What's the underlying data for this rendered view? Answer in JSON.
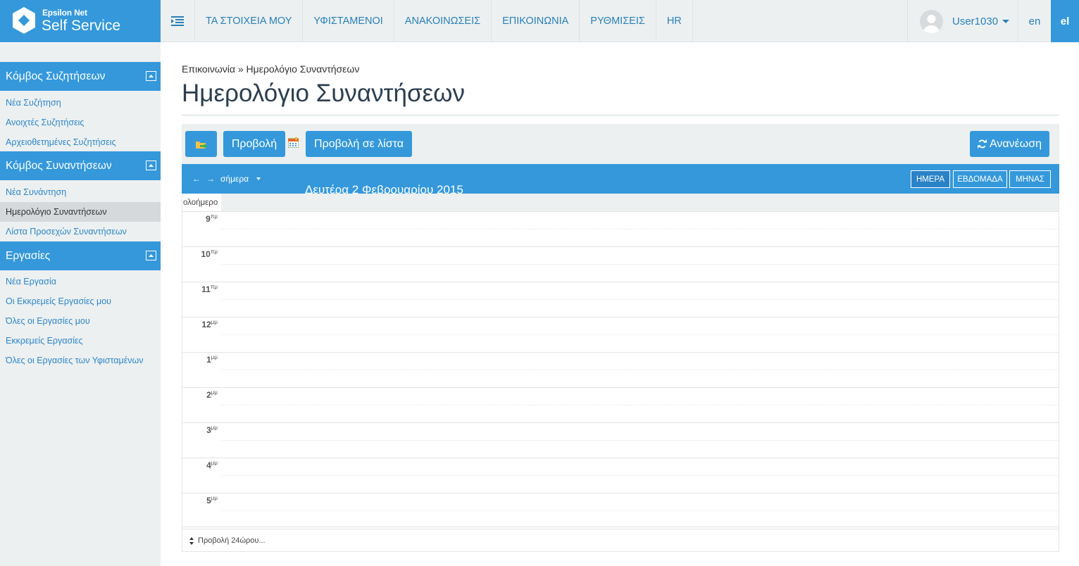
{
  "brand": {
    "small": "Epsilon Net",
    "big": "Self Service",
    "color": "#3498db"
  },
  "nav": {
    "items": [
      {
        "label": "ΤΑ ΣΤΟΙΧΕΙΑ ΜΟΥ"
      },
      {
        "label": "ΥΦΙΣΤΑΜΕΝΟΙ"
      },
      {
        "label": "ΑΝΑΚΟΙΝΩΣΕΙΣ"
      },
      {
        "label": "ΕΠΙΚΟΙΝΩΝΙΑ"
      },
      {
        "label": "ΡΥΘΜΙΣΕΙΣ"
      },
      {
        "label": "HR"
      }
    ],
    "user": "User1030",
    "lang_en": "en",
    "lang_el": "el"
  },
  "sidebar": {
    "sections": [
      {
        "title": "Κόμβος Συζητήσεων",
        "items": [
          "Νέα Συζήτηση",
          "Ανοιχτές Συζητήσεις",
          "Αρχειοθετημένες Συζητήσεις"
        ]
      },
      {
        "title": "Κόμβος Συναντήσεων",
        "items": [
          "Νέα Συνάντηση",
          "Ημερολόγιο Συναντήσεων",
          "Λίστα Προσεχών Συναντήσεων"
        ],
        "active": "Ημερολόγιο Συναντήσεων"
      },
      {
        "title": "Εργασίες",
        "items": [
          "Νέα Εργασία",
          "Οι Εκκρεμείς Εργασίες μου",
          "Όλες οι Εργασίες μου",
          "Εκκρεμείς Εργασίες",
          "Όλες οι Εργασίες των Υφισταμένων"
        ]
      }
    ]
  },
  "main": {
    "breadcrumb": "Επικοινωνία » Ημερολόγιο Συναντήσεων",
    "title": "Ημερολόγιο Συναντήσεων",
    "toolbar": {
      "view_label": "Προβολή",
      "list_view_label": "Προβολή σε λίστα",
      "refresh_label": "Ανανέωση"
    },
    "calendar": {
      "today_label": "σήμερα",
      "date_label": "Δευτέρα 2 Φεβρουαρίου 2015",
      "views": {
        "day": "ΗΜΕΡΑ",
        "week": "ΕΒΔΟΜΑΔΑ",
        "month": "ΜΗΝΑΣ"
      },
      "active_view": "ΗΜΕΡΑ",
      "allday_label": "ολοήμερο",
      "hours": [
        {
          "h": "9",
          "suffix": "πμ"
        },
        {
          "h": "10",
          "suffix": "πμ"
        },
        {
          "h": "11",
          "suffix": "πμ"
        },
        {
          "h": "12",
          "suffix": "μμ"
        },
        {
          "h": "1",
          "suffix": "μμ"
        },
        {
          "h": "2",
          "suffix": "μμ"
        },
        {
          "h": "3",
          "suffix": "μμ"
        },
        {
          "h": "4",
          "suffix": "μμ"
        },
        {
          "h": "5",
          "suffix": "μμ"
        }
      ],
      "footer_label": "Προβολή 24ώρου..."
    }
  }
}
